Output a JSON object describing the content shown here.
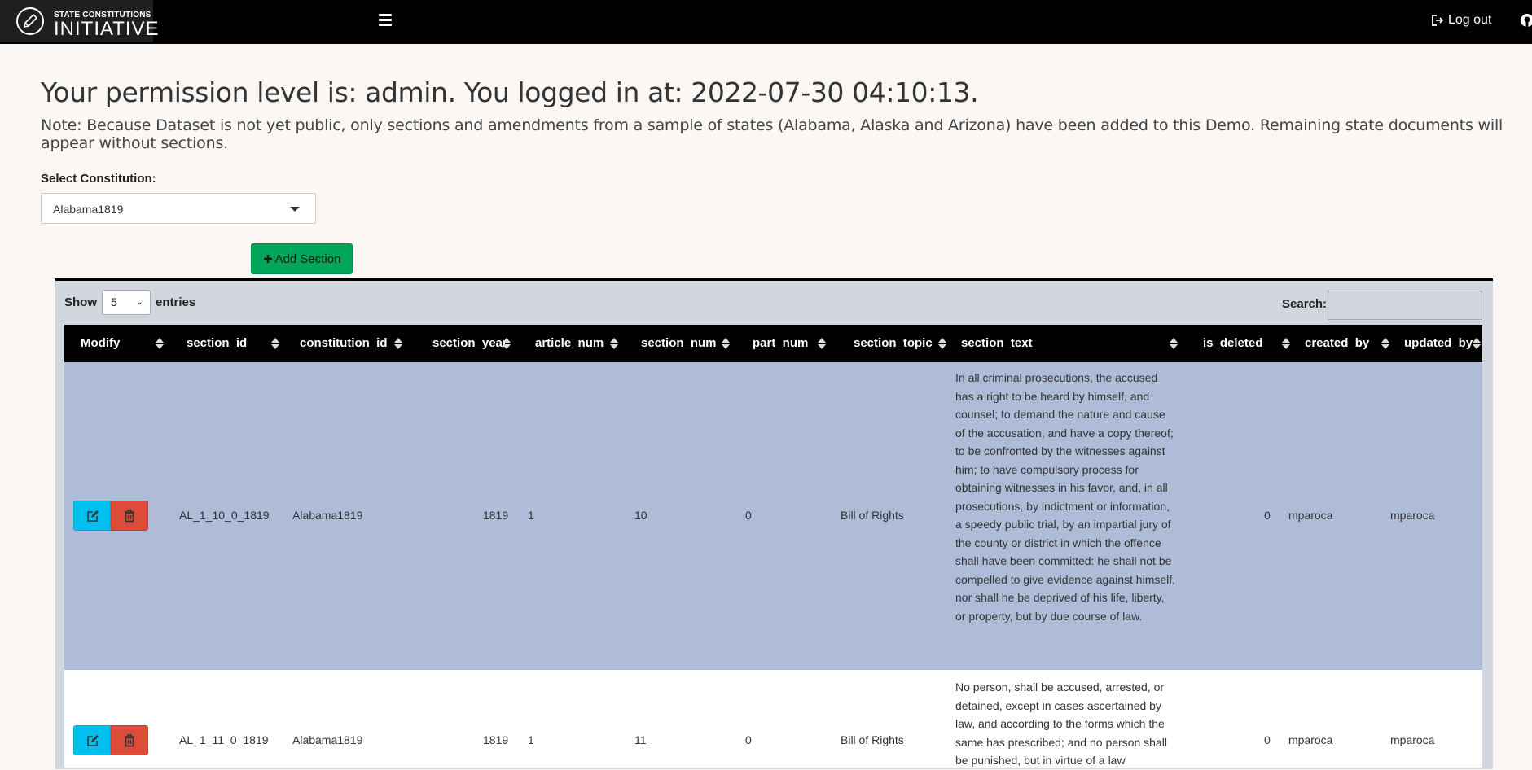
{
  "navbar": {
    "logo_small": "STATE CONSTITUTIONS",
    "logo_big": "INITIATIVE",
    "logout_label": "Log out"
  },
  "header": {
    "permission_text": "Your permission level is: admin. You logged in at: 2022-07-30 04:10:13.",
    "note": "Note: Because Dataset is not yet public, only sections and amendments from a sample of states (Alabama, Alaska and Arizona) have been added to this Demo. Remaining state documents will appear without sections."
  },
  "constitution_select": {
    "label": "Select Constitution:",
    "value": "Alabama1819"
  },
  "add_section_label": "Add Section",
  "table_controls": {
    "show_label": "Show",
    "length_value": "5",
    "entries_label": "entries",
    "search_label": "Search:",
    "search_value": ""
  },
  "columns": [
    "Modify",
    "section_id",
    "constitution_id",
    "section_year",
    "article_num",
    "section_num",
    "part_num",
    "section_topic",
    "section_text",
    "is_deleted",
    "created_by",
    "updated_by"
  ],
  "rows": [
    {
      "section_id": "AL_1_10_0_1819",
      "constitution_id": "Alabama1819",
      "section_year": "1819",
      "article_num": "1",
      "section_num": "10",
      "part_num": "0",
      "section_topic": "Bill of Rights",
      "section_text": "In all criminal prosecutions, the accused has a right to be heard by himself, and counsel; to demand the nature and cause of the accusation, and have a copy thereof; to be confronted by the witnesses against him; to have compulsory process for obtaining witnesses in his favor, and, in all prosecutions, by indictment or information, a speedy public trial, by an impartial jury of the county or district in which the offence shall have been committed: he shall not be compelled to give evidence against himself, nor shall he be deprived of his life, liberty, or property, but by due course of law.",
      "is_deleted": "0",
      "created_by": "mparoca",
      "updated_by": "mparoca"
    },
    {
      "section_id": "AL_1_11_0_1819",
      "constitution_id": "Alabama1819",
      "section_year": "1819",
      "article_num": "1",
      "section_num": "11",
      "part_num": "0",
      "section_topic": "Bill of Rights",
      "section_text": "No person, shall be accused, arrested, or detained, except in cases ascertained by law, and according to the forms which the same has prescribed; and no person shall be punished, but in virtue of a law",
      "is_deleted": "0",
      "created_by": "mparoca",
      "updated_by": "mparoca"
    }
  ]
}
